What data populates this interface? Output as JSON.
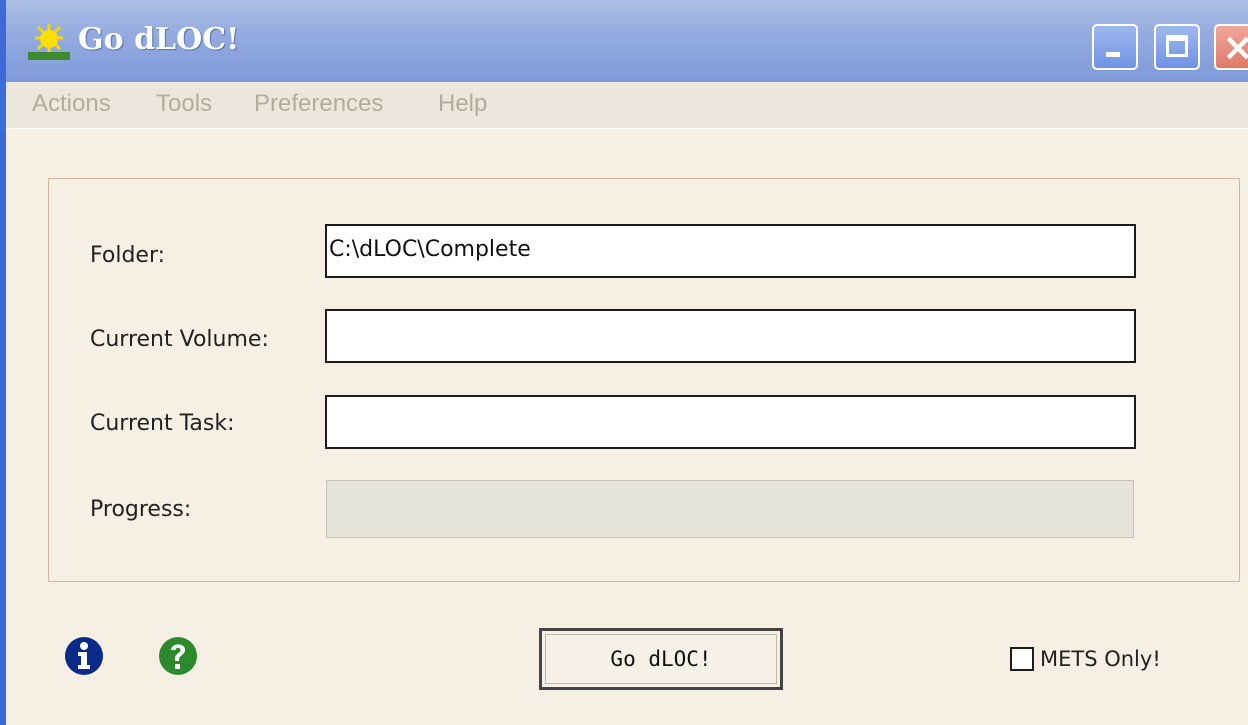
{
  "window": {
    "title": "Go dLOC!",
    "controls": {
      "minimize": "minimize",
      "maximize": "maximize",
      "close": "×"
    }
  },
  "menu": {
    "items": [
      "Actions",
      "Tools",
      "Preferences",
      "Help"
    ]
  },
  "form": {
    "folder_label": "Folder:",
    "folder_value": "C:\\dLOC\\Complete",
    "volume_label": "Current Volume:",
    "volume_value": "",
    "task_label": "Current Task:",
    "task_value": "",
    "progress_label": "Progress:",
    "progress_value": 0
  },
  "footer": {
    "info_icon": "info-icon",
    "help_icon": "help-icon",
    "go_button_label": "Go dLOC!",
    "mets_only_label": "METS Only!",
    "mets_only_checked": false
  },
  "colors": {
    "titlebar": "#8aa3de",
    "window_bg": "#f5efe4",
    "info_blue": "#0a2a8a",
    "help_green": "#2c8a2c"
  }
}
